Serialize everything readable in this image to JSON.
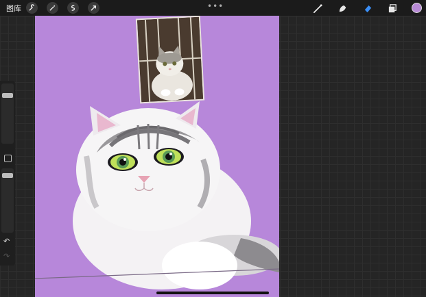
{
  "toolbar": {
    "gallery_label": "图库",
    "left_tools": [
      {
        "icon": "wrench-icon"
      },
      {
        "icon": "magic-wand-icon"
      },
      {
        "icon": "selection-icon"
      },
      {
        "icon": "transform-arrow-icon"
      }
    ],
    "more_label": "•••",
    "right_tools": [
      {
        "icon": "brush-icon"
      },
      {
        "icon": "smudge-icon"
      },
      {
        "icon": "eraser-icon"
      },
      {
        "icon": "layers-icon"
      }
    ],
    "current_color": "#b88ad6",
    "accent_color": "#3a8ef6"
  },
  "sidebar": {
    "undo_icon": "↶",
    "redo_icon": "↷"
  },
  "canvas": {
    "background_color": "#b787da",
    "subject": "cat-illustration",
    "reference": "reference-cat-photo"
  }
}
